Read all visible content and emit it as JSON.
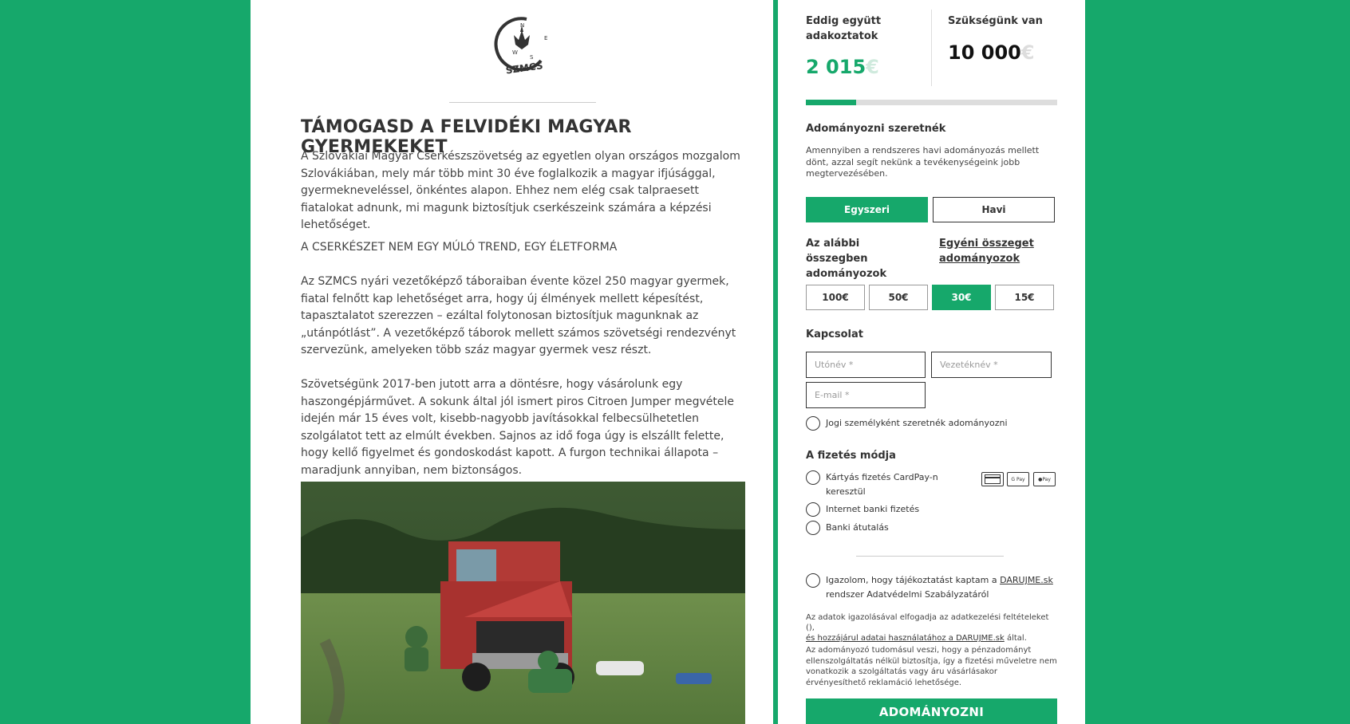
{
  "logo": {
    "text": "SZMCS",
    "compass_letters": [
      "N",
      "E",
      "S",
      "W"
    ]
  },
  "article": {
    "title": "TÁMOGASD A FELVIDÉKI MAGYAR GYERMEKEKET",
    "p1": "A Szlovákiai Magyar Cserkészszövetség az egyetlen olyan országos mozgalom Szlovákiában, mely már több mint 30 éve foglalkozik a magyar ifjúsággal, gyermekneveléssel, önkéntes alapon. Ehhez nem elég csak talpraesett fiatalokat adnunk, mi magunk biztosítjuk cserkészeink számára a képzési lehetőséget.",
    "p2": "A CSERKÉSZET NEM EGY MÚLÓ TREND, EGY ÉLETFORMA",
    "p3": "Az SZMCS nyári vezetőképző táboraiban évente közel 250 magyar gyermek, fiatal felnőtt kap lehetőséget arra, hogy új élmények mellett képesítést, tapasztalatot szerezzen – ezáltal folytonosan biztosítjuk magunknak az „utánpótlást”. A vezetőképző táborok mellett számos szövetségi rendezvényt szervezünk, amelyeken több száz magyar gyermek vesz részt.",
    "p4": "Szövetségünk 2017-ben jutott arra a döntésre, hogy vásárolunk egy haszongépjárművet. A sokunk által jól ismert piros Citroen Jumper megvétele idején már 15 éves volt, kisebb-nagyobb javításokkal felbecsülhetetlen szolgálatot tett az elmúlt években. Sajnos az idő foga úgy is elszállt felette, hogy kellő figyelmet és gondoskodást kapott. A furgon technikai állapota – maradjunk annyiban, nem biztonságos."
  },
  "stats": {
    "raised_label": "Eddig együtt adakoztatok",
    "raised_amount": "2 015",
    "raised_currency": "€",
    "goal_label": "Szükségünk van",
    "goal_amount": "10 000",
    "goal_currency": "€",
    "progress_fraction": 0.2015
  },
  "donation": {
    "title": "Adományozni szeretnék",
    "note": "Amennyiben a rendszeres havi adományozás mellett dönt, azzal segít nekünk a tevékenységeink jobb megtervezésében.",
    "tab_once": "Egyszeri",
    "tab_monthly": "Havi",
    "preset_label": "Az alábbi összegben adományozok",
    "custom_label": "Egyéni összeget adományozok",
    "amounts": [
      "100€",
      "50€",
      "30€",
      "15€"
    ]
  },
  "contact": {
    "title": "Kapcsolat",
    "first_name_placeholder": "Utónév *",
    "last_name_placeholder": "Vezetéknév *",
    "email_placeholder": "E-mail *",
    "company_label": "Jogi személyként szeretnék adományozni"
  },
  "payment": {
    "title": "A fizetés módja",
    "card_label": "Kártyás fizetés CardPay-n keresztül",
    "internet_label": "Internet banki fizetés",
    "transfer_label": "Banki átutalás",
    "gpay_text": "G Pay",
    "applepay_text": "Pay"
  },
  "consent": {
    "text_pre": "Igazolom, hogy tájékoztatást kaptam a ",
    "link": "DARUJME.sk",
    "text_post": " rendszer Adatvédelmi Szabályzatáról",
    "fine1_a": "Az adatok igazolásával elfogadja az adatkezelési feltételeket (),",
    "fine1_b": "és hozzájárul adatai használatához a DARUJME.sk",
    "fine1_c": " által.",
    "fine2": "Az adományozó tudomásul veszi, hogy a pénzadományt ellenszolgáltatás nélkül biztosítja, így a fizetési műveletre nem vonatkozik a szolgáltatás vagy áru vásárlásakor érvényesíthető reklamáció lehetősége."
  },
  "cta": "ADOMÁNYOZNI",
  "colors": {
    "brand": "#16a86b"
  }
}
